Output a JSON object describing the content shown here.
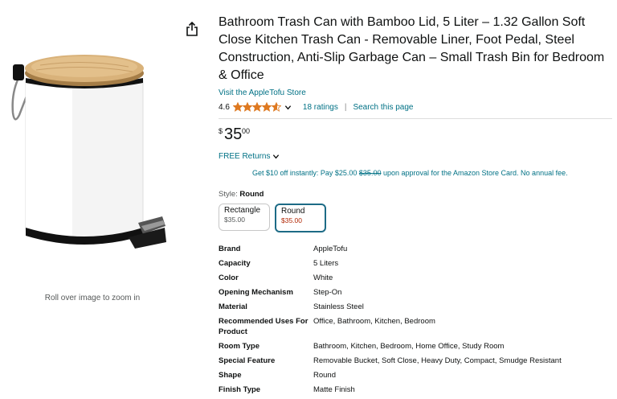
{
  "image": {
    "zoom_hint": "Roll over image to zoom in"
  },
  "product": {
    "title": "Bathroom Trash Can with Bamboo Lid, 5 Liter – 1.32 Gallon Soft Close Kitchen Trash Can - Removable Liner, Foot Pedal, Steel Construction, Anti-Slip Garbage Can – Small Trash Bin for Bedroom & Office",
    "store_link": "Visit the AppleTofu Store",
    "rating": "4.6",
    "rating_value": 4.6,
    "ratings_count": "18 ratings",
    "separator": "|",
    "search_link": "Search this page",
    "price": {
      "currency": "$",
      "whole": "35",
      "fraction": "00"
    },
    "returns": "FREE Returns",
    "promo": {
      "prefix": "Get $10 off instantly: Pay $25.00 ",
      "strike": "$35.00",
      "suffix": " upon approval for the Amazon Store Card. No annual fee."
    },
    "style": {
      "label": "Style:",
      "selected": "Round"
    },
    "options": [
      {
        "name": "Rectangle",
        "price": "$35.00"
      },
      {
        "name": "Round",
        "price": "$35.00"
      }
    ],
    "specs": [
      {
        "key": "Brand",
        "value": "AppleTofu"
      },
      {
        "key": "Capacity",
        "value": "5 Liters"
      },
      {
        "key": "Color",
        "value": "White"
      },
      {
        "key": "Opening Mechanism",
        "value": "Step-On"
      },
      {
        "key": "Material",
        "value": "Stainless Steel"
      },
      {
        "key": "Recommended Uses For Product",
        "value": "Office, Bathroom, Kitchen, Bedroom"
      },
      {
        "key": "Room Type",
        "value": "Bathroom, Kitchen, Bedroom, Home Office, Study Room"
      },
      {
        "key": "Special Feature",
        "value": "Removable Bucket, Soft Close, Heavy Duty, Compact, Smudge Resistant"
      },
      {
        "key": "Shape",
        "value": "Round"
      },
      {
        "key": "Finish Type",
        "value": "Matte Finish"
      }
    ]
  },
  "colors": {
    "link": "#007185",
    "star": "#de7921",
    "price_red": "#b12704",
    "selected_border": "#1d6b86"
  },
  "icons": {
    "share": "share-icon",
    "star": "star-icon",
    "chevron": "chevron-down-icon"
  }
}
